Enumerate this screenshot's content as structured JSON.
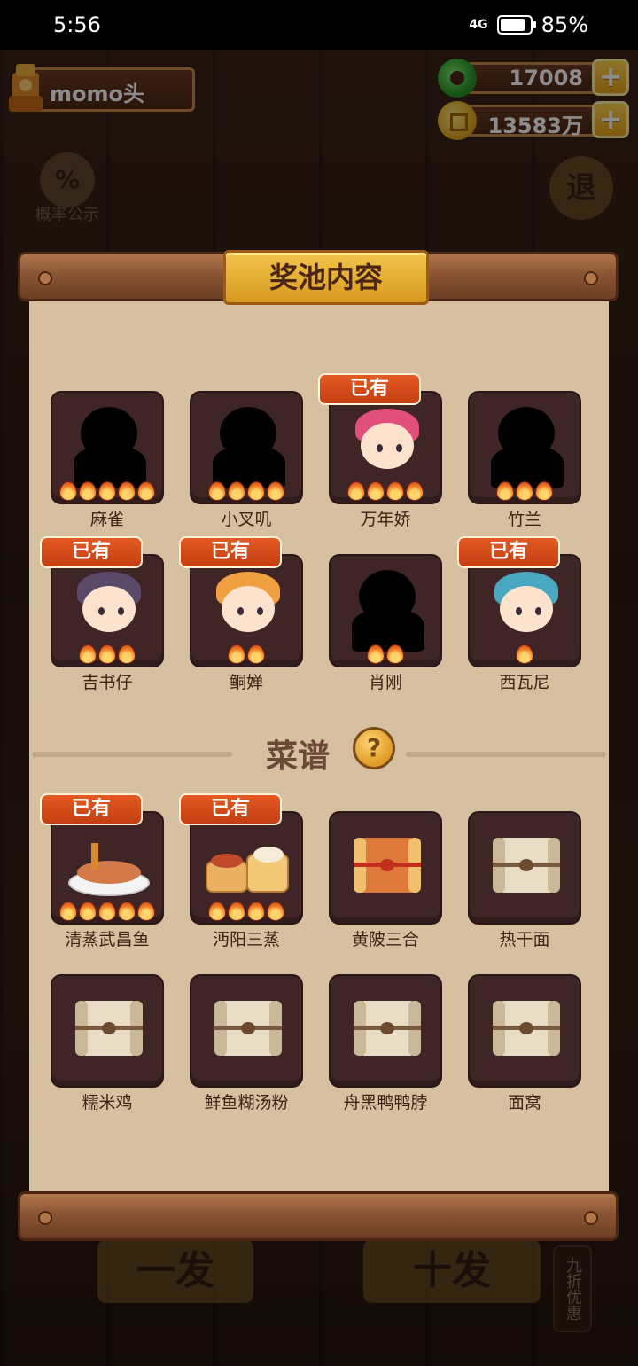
{
  "status_bar": {
    "time": "5:56",
    "network": "4G",
    "battery_text": "85%",
    "battery_level": 0.85
  },
  "player": {
    "name": "momo头"
  },
  "currencies": [
    {
      "icon": "jade-icon",
      "value": "17008"
    },
    {
      "icon": "coin-icon",
      "value": "13583万"
    }
  ],
  "background_buttons": {
    "probability": "概率公示",
    "exit": "退",
    "single_draw": "一发",
    "ten_draw": "十发",
    "discount": "九折优惠"
  },
  "panel": {
    "title": "奖池内容"
  },
  "owned_label": "已有",
  "characters": [
    {
      "name": "麻雀",
      "owned": false,
      "stars": 5
    },
    {
      "name": "小叉叽",
      "owned": false,
      "stars": 4
    },
    {
      "name": "万年娇",
      "owned": true,
      "stars": 4
    },
    {
      "name": "竹兰",
      "owned": false,
      "stars": 3
    },
    {
      "name": "吉书仔",
      "owned": true,
      "stars": 3
    },
    {
      "name": "鲖婵",
      "owned": true,
      "stars": 2
    },
    {
      "name": "肖刚",
      "owned": false,
      "stars": 2
    },
    {
      "name": "西瓦尼",
      "owned": true,
      "stars": 1
    }
  ],
  "recipes_section": {
    "title": "菜谱",
    "help_icon": "question-icon"
  },
  "recipes": [
    {
      "name": "清蒸武昌鱼",
      "owned": true,
      "stars": 5,
      "icon": "fish-dish"
    },
    {
      "name": "沔阳三蒸",
      "owned": true,
      "stars": 4,
      "icon": "steamed-dish"
    },
    {
      "name": "黄陂三合",
      "owned": false,
      "stars": 0,
      "icon": "red-scroll"
    },
    {
      "name": "热干面",
      "owned": false,
      "stars": 0,
      "icon": "scroll"
    },
    {
      "name": "糯米鸡",
      "owned": false,
      "stars": 0,
      "icon": "scroll"
    },
    {
      "name": "鲜鱼糊汤粉",
      "owned": false,
      "stars": 0,
      "icon": "scroll"
    },
    {
      "name": "舟黑鸭鸭脖",
      "owned": false,
      "stars": 0,
      "icon": "scroll"
    },
    {
      "name": "面窝",
      "owned": false,
      "stars": 0,
      "icon": "scroll"
    }
  ],
  "colors": {
    "panel_bg": "#d6c0a0",
    "card_bg": "#402527",
    "owned_badge": "#d84c1a",
    "title_badge": "#e8b02e",
    "rod": "#8a5434"
  }
}
